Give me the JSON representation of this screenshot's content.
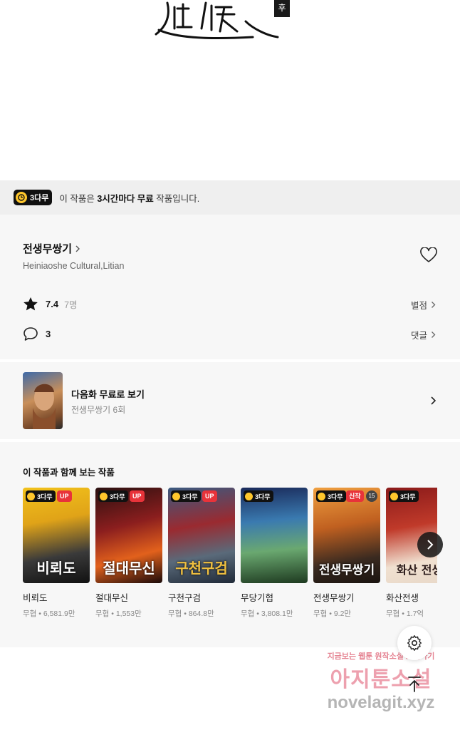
{
  "hero": {
    "seal_text": "후"
  },
  "free_bar": {
    "badge": "3다무",
    "message_prefix": "이 작품은 ",
    "message_bold": "3시간마다 무료",
    "message_suffix": " 작품입니다."
  },
  "work": {
    "title": "전생무쌍기",
    "author": "Heiniaoshe Cultural,Litian",
    "rating": "7.4",
    "rating_count": "7명",
    "rating_link": "별점",
    "comment_count": "3",
    "comment_link": "댓글"
  },
  "next_episode": {
    "title": "다음화 무료로 보기",
    "subtitle": "전생무쌍기 6회"
  },
  "recommendations": {
    "heading": "이 작품과 함께 보는 작품",
    "items": [
      {
        "name": "비뢰도",
        "meta": "무협 • 6,581.9만",
        "badge": "3다무",
        "tag": "UP",
        "cover_text": "비뢰도"
      },
      {
        "name": "절대무신",
        "meta": "무협 • 1,553만",
        "badge": "3다무",
        "tag": "UP",
        "cover_text": "절대무신"
      },
      {
        "name": "구천구검",
        "meta": "무협 • 864.8만",
        "badge": "3다무",
        "tag": "UP",
        "cover_text": "구천구검"
      },
      {
        "name": "무당기협",
        "meta": "무협 • 3,808.1만",
        "badge": "3다무",
        "tag": "",
        "cover_text": ""
      },
      {
        "name": "전생무쌍기",
        "meta": "무협 • 9.2만",
        "badge": "3다무",
        "tag": "신작",
        "age": "15",
        "cover_text": "전생무쌍기"
      },
      {
        "name": "화산전생",
        "meta": "무협 • 1.7억",
        "badge": "3다무",
        "tag": "",
        "cover_text": "화산 전생"
      }
    ]
  },
  "watermark": {
    "line1": "지금보는 웹툰 원작소설 보러가기",
    "line2": "아지툰소설",
    "line3": "novelagit.xyz"
  },
  "colors": {
    "badge_bg": "#111111",
    "clock": "#ffc72c",
    "up_tag": "#e8333a"
  }
}
